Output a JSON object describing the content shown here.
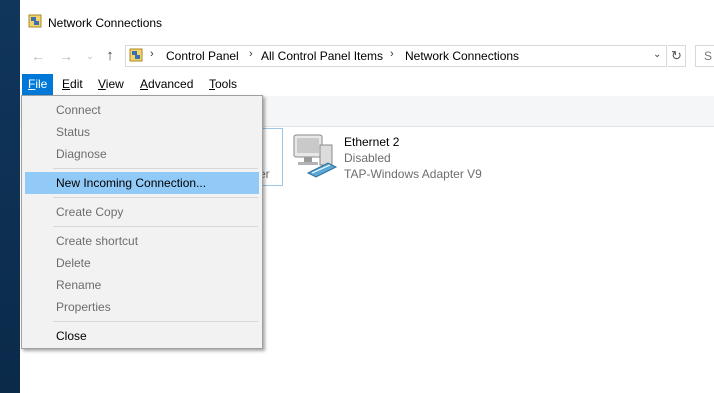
{
  "window": {
    "title": "Network Connections"
  },
  "address": {
    "crumbs": [
      "Control Panel",
      "All Control Panel Items",
      "Network Connections"
    ],
    "search_text": "S"
  },
  "menubar": {
    "items": [
      {
        "first": "F",
        "rest": "ile"
      },
      {
        "first": "E",
        "rest": "dit"
      },
      {
        "first": "V",
        "rest": "iew"
      },
      {
        "first": "A",
        "rest": "dvanced"
      },
      {
        "first": "T",
        "rest": "ools"
      }
    ]
  },
  "file_menu": {
    "items": [
      {
        "label": "Connect",
        "enabled": false
      },
      {
        "label": "Status",
        "enabled": false
      },
      {
        "label": "Diagnose",
        "enabled": false
      },
      {
        "label": "New Incoming Connection...",
        "enabled": true,
        "highlighted": true
      },
      {
        "label": "Create Copy",
        "enabled": false
      },
      {
        "label": "Create shortcut",
        "enabled": false
      },
      {
        "label": "Delete",
        "enabled": false
      },
      {
        "label": "Rename",
        "enabled": false
      },
      {
        "label": "Properties",
        "enabled": false
      },
      {
        "label": "Close",
        "enabled": true
      }
    ]
  },
  "adapters": {
    "partial_suffix": "er",
    "ethernet2": {
      "name": "Ethernet 2",
      "status": "Disabled",
      "device": "TAP-Windows Adapter V9"
    }
  },
  "colors": {
    "accent": "#0078d7",
    "highlight": "#91c9f7",
    "disabled_text": "#6d6d6d"
  }
}
